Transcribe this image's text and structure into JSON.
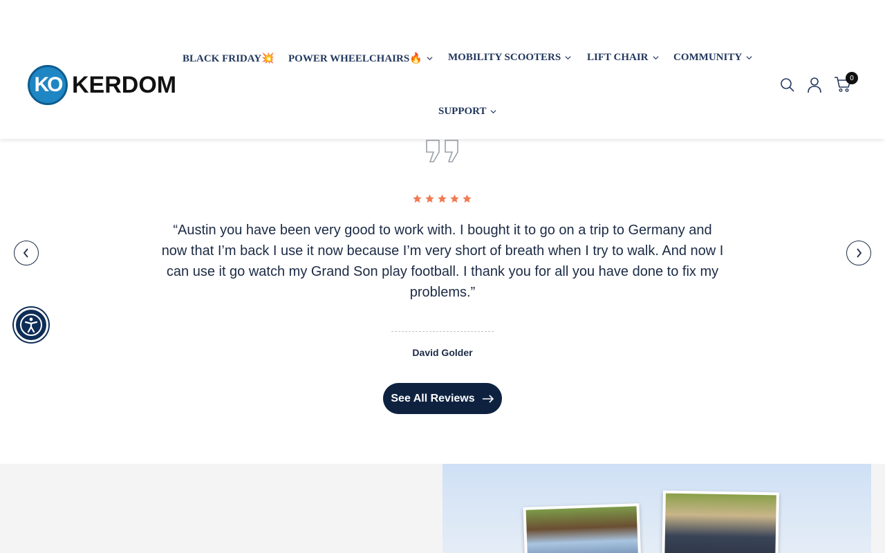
{
  "brand": {
    "name": "KERDOM",
    "mark": "KO"
  },
  "nav": {
    "items": [
      {
        "label": "BLACK FRIDAY💥",
        "has_dropdown": false
      },
      {
        "label": "POWER WHEELCHAIRS🔥",
        "has_dropdown": true
      },
      {
        "label": "MOBILITY SCOOTERS",
        "has_dropdown": true
      },
      {
        "label": "LIFT CHAIR",
        "has_dropdown": true
      },
      {
        "label": "COMMUNITY",
        "has_dropdown": true
      },
      {
        "label": "SUPPORT",
        "has_dropdown": true
      }
    ]
  },
  "header_icons": [
    "search-icon",
    "account-icon",
    "cart-icon"
  ],
  "cart": {
    "count": "0"
  },
  "testimonial": {
    "rating": 5,
    "text": "“Austin you have been very good to work with. I bought it to go on a trip to Germany and now that I’m back I use it now because I’m very short of breath when I try to walk. And now I can use it go watch my Grand Son play football. I thank you for all you have done to fix my problems.”",
    "author": "David Golder",
    "cta_label": "See All Reviews"
  },
  "colors": {
    "navy": "#0e2240",
    "nav_text": "#22385e",
    "star": "#f07a52",
    "brand_blue": "#1f86c4"
  }
}
